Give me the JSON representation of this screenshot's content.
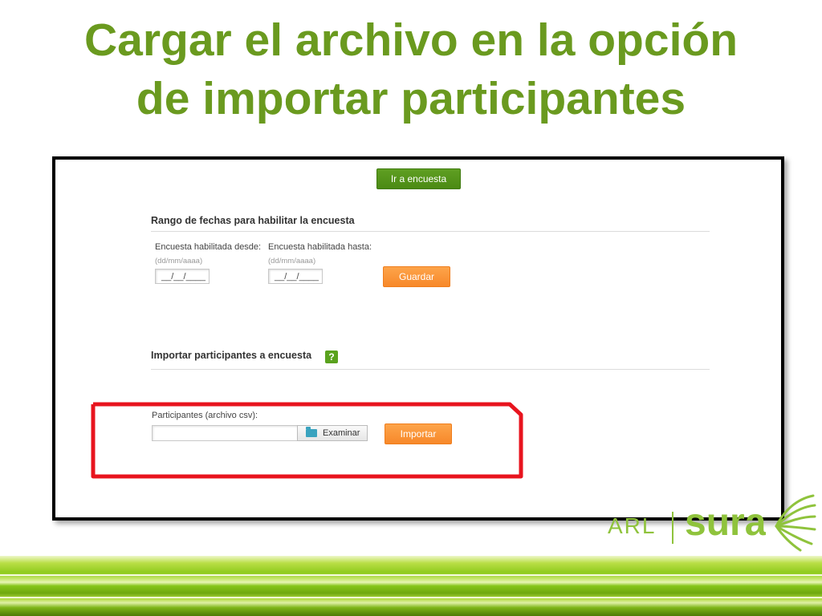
{
  "slide": {
    "title_line1": "Cargar el archivo en la opción",
    "title_line2": "de importar participantes"
  },
  "form": {
    "go_button": "Ir a encuesta",
    "dates_section_title": "Rango de fechas para habilitar la encuesta",
    "from_label": "Encuesta habilitada desde:",
    "from_hint": "(dd/mm/aaaa)",
    "from_value": "__/__/____",
    "to_label": "Encuesta habilitada hasta:",
    "to_hint": "(dd/mm/aaaa)",
    "to_value": "__/__/____",
    "save_button": "Guardar",
    "import_section_title": "Importar participantes a encuesta",
    "help_icon": "?",
    "file_label": "Participantes (archivo csv):",
    "file_value": "",
    "browse_button": "Examinar",
    "import_button": "Importar"
  },
  "logo": {
    "left": "ARL",
    "right": "sura"
  },
  "colors": {
    "title": "#6a9a1f",
    "green_button": "#4f8f16",
    "orange_button": "#f7882a",
    "highlight": "#e8141e",
    "logo": "#8fc33c"
  }
}
